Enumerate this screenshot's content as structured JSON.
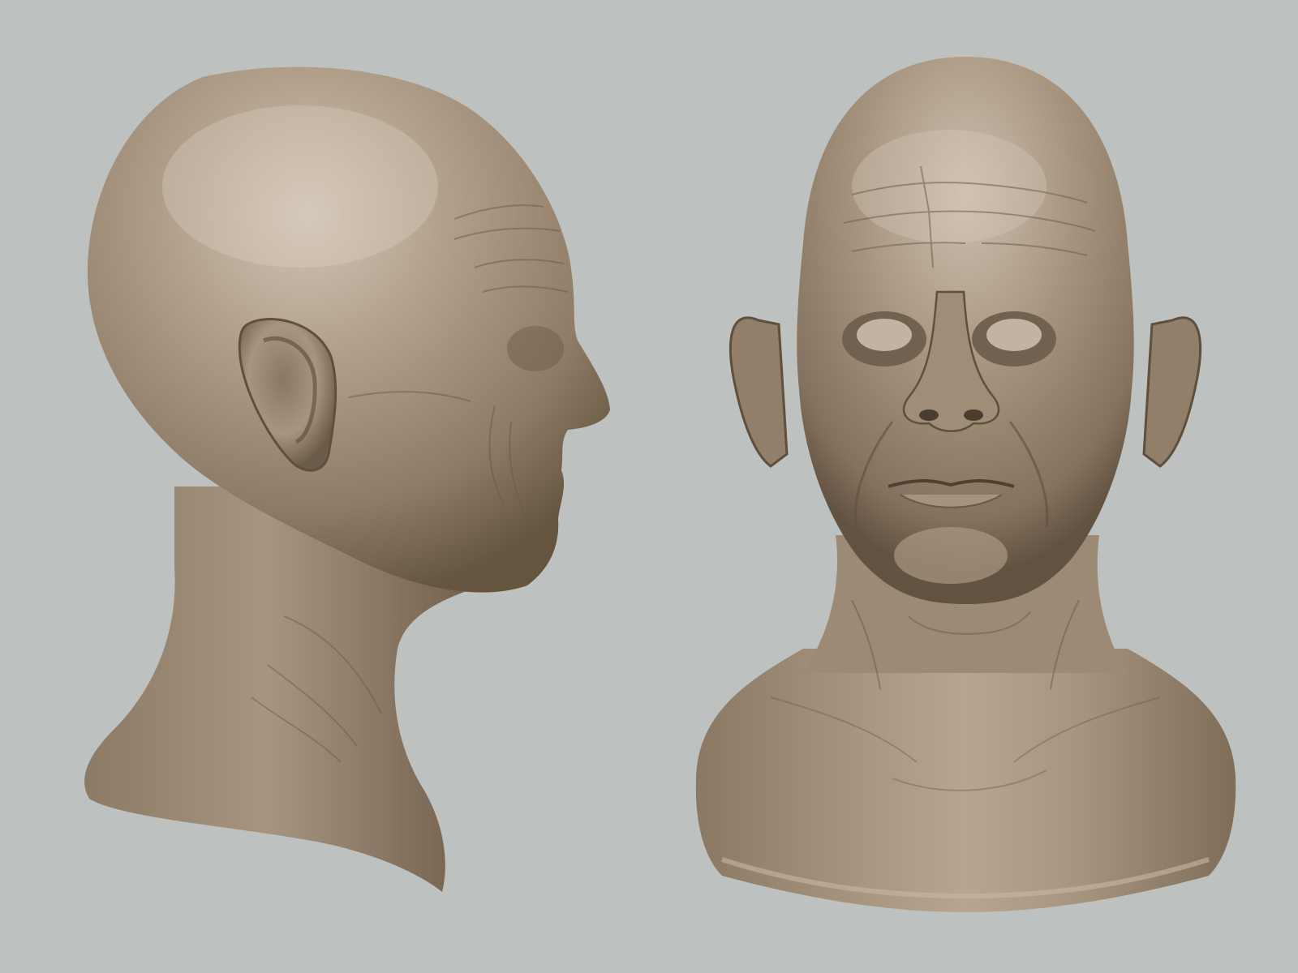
{
  "scene": {
    "background": "#bdc2c1",
    "sculpt_base_color": "#9c8a76",
    "sculpt_highlight_color": "#cfc1b1",
    "sculpt_shadow_color": "#5e4f40",
    "views": [
      {
        "view": "side-profile"
      },
      {
        "view": "front"
      }
    ]
  }
}
